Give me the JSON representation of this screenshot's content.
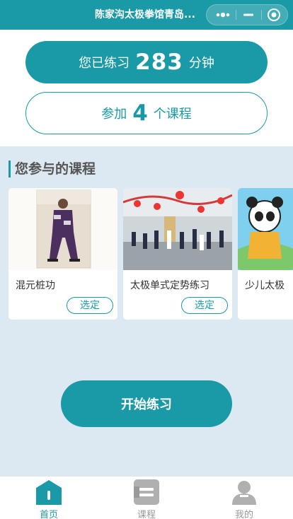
{
  "titlebar": {
    "title": "陈家沟太极拳馆青岛..."
  },
  "stats": {
    "practice_prefix": "您已练习",
    "practice_minutes": "283",
    "practice_suffix": "分钟",
    "courses_prefix": "参加",
    "courses_count": "4",
    "courses_suffix": "个课程"
  },
  "section": {
    "title": "您参与的课程"
  },
  "courses": [
    {
      "title": "混元桩功",
      "button": "选定"
    },
    {
      "title": "太极单式定势练习",
      "button": "选定"
    },
    {
      "title": "少儿太极",
      "button": ""
    }
  ],
  "start_button": "开始练习",
  "tabs": [
    {
      "label": "首页",
      "icon": "home-icon",
      "active": true
    },
    {
      "label": "课程",
      "icon": "course-icon",
      "active": false
    },
    {
      "label": "我的",
      "icon": "user-icon",
      "active": false
    }
  ],
  "colors": {
    "accent": "#1a9aa6",
    "background": "#dce8f2",
    "inactive": "#b0b0b0"
  }
}
